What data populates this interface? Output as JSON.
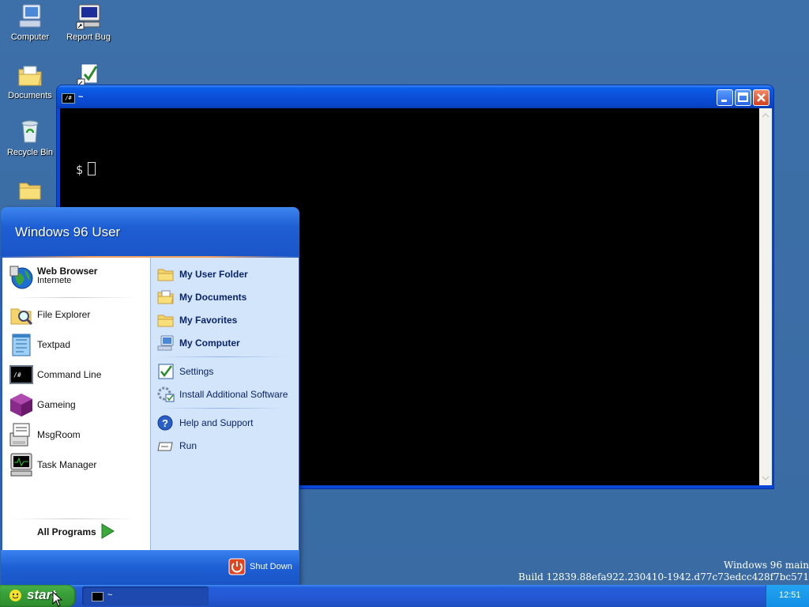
{
  "desktop": {
    "icons": [
      {
        "label": "Computer"
      },
      {
        "label": "Report Bug"
      },
      {
        "label": "Documents"
      },
      {
        "label": ""
      },
      {
        "label": "Recycle Bin"
      },
      {
        "label": ""
      }
    ]
  },
  "terminal": {
    "title": "~",
    "title_icon_text": "/#",
    "prompt": "$"
  },
  "start_menu": {
    "user_name": "Windows 96 User",
    "pinned": [
      {
        "label": "Web Browser",
        "sublabel": "Internete"
      }
    ],
    "recent": [
      {
        "label": "File Explorer"
      },
      {
        "label": "Textpad"
      },
      {
        "label": "Command Line"
      },
      {
        "label": "Gameing"
      },
      {
        "label": "MsgRoom"
      },
      {
        "label": "Task Manager"
      }
    ],
    "all_programs": "All Programs",
    "places": [
      {
        "label": "My User Folder"
      },
      {
        "label": "My Documents"
      },
      {
        "label": "My Favorites"
      },
      {
        "label": "My Computer"
      }
    ],
    "tools": [
      {
        "label": "Settings"
      },
      {
        "label": "Install Additional Software"
      }
    ],
    "help": [
      {
        "label": "Help and Support"
      },
      {
        "label": "Run"
      }
    ],
    "shutdown": "Shut Down"
  },
  "taskbar": {
    "start_label": "start",
    "tasks": [
      {
        "label": "~",
        "icon_text": "/#"
      }
    ],
    "clock": "12:51"
  },
  "watermark": {
    "line1": "Windows 96 main",
    "line2": "Build 12839.88efa922.230410-1942.d77c73edcc428f7bc571"
  },
  "colors": {
    "desktop": "#3a6ea5",
    "titlebar": "#0a4fd8",
    "start_green": "#38a038",
    "menu_right": "#d3e5fa"
  }
}
